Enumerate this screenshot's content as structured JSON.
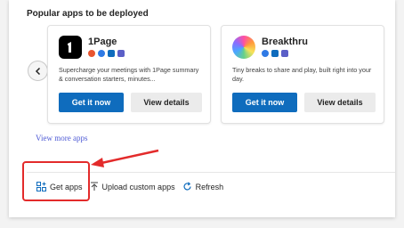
{
  "section": {
    "title": "Popular apps to be deployed"
  },
  "carousel": {
    "prev_icon": "chevron-left-icon"
  },
  "apps": [
    {
      "name": "1Page",
      "logo_icon": "1page-logo-icon",
      "description": "Supercharge your meetings with 1Page summary & conversation starters, minutes...",
      "get_label": "Get it now",
      "details_label": "View details",
      "host_icons": [
        "loop-icon",
        "copilot-icon",
        "outlook-icon",
        "teams-icon"
      ]
    },
    {
      "name": "Breakthru",
      "logo_icon": "breakthru-logo-icon",
      "description": "Tiny breaks to share and play, built right into your day.",
      "get_label": "Get it now",
      "details_label": "View details",
      "host_icons": [
        "copilot-icon",
        "outlook-icon",
        "teams-icon"
      ]
    }
  ],
  "links": {
    "view_more": "View more apps"
  },
  "toolbar": {
    "get_apps": "Get apps",
    "upload_custom_apps": "Upload custom apps",
    "refresh": "Refresh"
  },
  "colors": {
    "primary": "#0f6cbd",
    "highlight": "#e32b2b",
    "link": "#4f5bd5"
  }
}
